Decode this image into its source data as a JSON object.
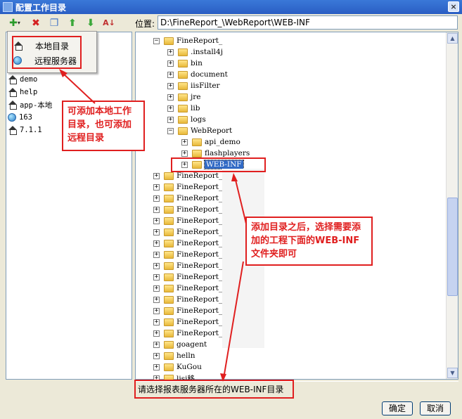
{
  "window": {
    "title": "配置工作目录",
    "close_glyph": "×"
  },
  "dropdown": {
    "items": [
      {
        "label": "本地目录",
        "icon": "house-icon"
      },
      {
        "label": "远程服务器",
        "icon": "globe-icon"
      }
    ]
  },
  "left_tree": {
    "items": [
      {
        "label": "demo",
        "icon": "house-icon"
      },
      {
        "label": "help",
        "icon": "house-icon"
      },
      {
        "label": "app-本地",
        "icon": "house-icon"
      },
      {
        "label": "163",
        "icon": "globe-icon"
      },
      {
        "label": "7.1.1",
        "icon": "house-icon"
      }
    ]
  },
  "location": {
    "label": "位置:",
    "value": "D:\\FineReport_\\WebReport\\WEB-INF"
  },
  "right_tree": {
    "root": "FineReport_",
    "children": [
      ".install4j",
      "bin",
      "document",
      "iisFilter",
      "jre",
      "lib",
      "logs",
      "WebReport"
    ],
    "webreport_children": [
      "api_demo",
      "flashplayers",
      "WEB-INF"
    ],
    "siblings": [
      "FineReport_",
      "FineReport_",
      "FineReport_",
      "FineReport_",
      "FineReport_",
      "FineReport_",
      "FineReport_",
      "FineReport_",
      "FineReport_",
      "FineReport_",
      "FineReport_",
      "FineReport_",
      "FineReport_",
      "FineReport_",
      "FineReport_"
    ],
    "tail": [
      "goagent",
      "helln",
      "KuGou",
      "lisi移"
    ]
  },
  "status": {
    "text": "请选择报表服务器所在的WEB-INF目录"
  },
  "buttons": {
    "ok": "确定",
    "cancel": "取消"
  },
  "annotations": {
    "left": "可添加本地工作目录，也可添加远程目录",
    "right": "添加目录之后，选择需要添加的工程下面的WEB-INF文件夹即可"
  },
  "colors": {
    "accent_red": "#e01f1f",
    "selection": "#316ac5"
  }
}
